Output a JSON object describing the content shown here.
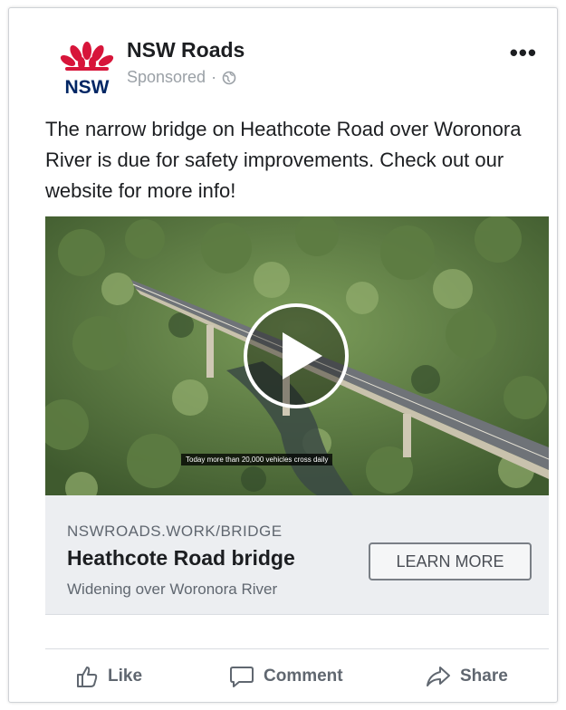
{
  "post": {
    "page_name": "NSW Roads",
    "sponsored_label": "Sponsored",
    "separator": "·",
    "more_label": "•••",
    "text": "The narrow bridge on Heathcote Road over Woronora River is due for safety improvements. Check out our website for more info!",
    "logo_text": "NSW"
  },
  "media": {
    "caption": "Today more than 20,000 vehicles cross daily"
  },
  "link": {
    "domain": "NSWROADS.WORK/BRIDGE",
    "title": "Heathcote Road bridge",
    "description": "Widening over Woronora River",
    "cta_label": "LEARN MORE"
  },
  "actions": {
    "like": "Like",
    "comment": "Comment",
    "share": "Share"
  },
  "colors": {
    "brand_red": "#d7153a",
    "brand_navy": "#002664",
    "muted_text": "#606770"
  },
  "icons": [
    "waratah-logo-icon",
    "globe-icon",
    "play-icon",
    "thumbs-up-icon",
    "comment-icon",
    "share-icon"
  ]
}
